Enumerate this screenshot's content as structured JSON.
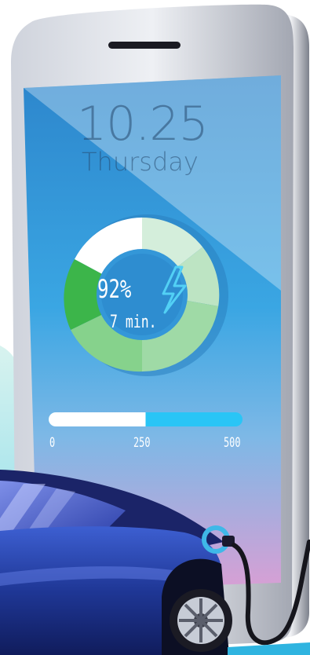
{
  "lockscreen": {
    "time": "10.25",
    "day": "Thursday"
  },
  "charging": {
    "percent_label": "92%",
    "time_label": "7 min.",
    "level": 0.92
  },
  "range_bar": {
    "ticks": [
      "0",
      "250",
      "500"
    ],
    "filled_fraction": 0.5
  },
  "colors": {
    "screen_top": "#2f8fd0",
    "screen_bottom": "#d9a0d6",
    "ring_light_green": "#d4eedb",
    "ring_mid_green": "#86d28c",
    "ring_dark_green": "#3cb54a",
    "ring_empty": "#ffffff",
    "bolt": "#4fc3f7",
    "bar_fill": "#ffffff",
    "bar_track": "#29c5f6",
    "car_body": "#1c2f8a",
    "charger": "#3fb8e8"
  },
  "icons": {
    "charging": "lightning-bolt-icon",
    "notch": "speaker-slot-icon",
    "car": "electric-car-icon",
    "charger": "charging-plug-icon"
  }
}
